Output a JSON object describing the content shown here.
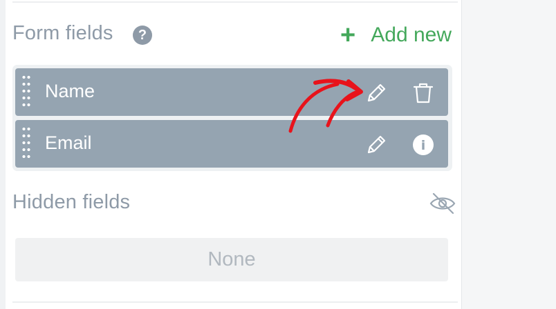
{
  "form_fields": {
    "title": "Form fields",
    "help_glyph": "?",
    "add_new_label": "Add new",
    "add_new_glyph": "+",
    "fields": [
      {
        "label": "Name",
        "actions": [
          "edit-icon",
          "trash-icon"
        ]
      },
      {
        "label": "Email",
        "actions": [
          "edit-icon",
          "info-icon"
        ]
      }
    ]
  },
  "hidden_fields": {
    "title": "Hidden fields",
    "toggle_icon": "eye-off-icon",
    "empty_label": "None"
  },
  "colors": {
    "accent_green": "#44a85b",
    "field_row_bg": "#95a4b1",
    "muted_text": "#8e9aa7",
    "annotation_red": "#e8131b"
  },
  "info_glyph": "i"
}
